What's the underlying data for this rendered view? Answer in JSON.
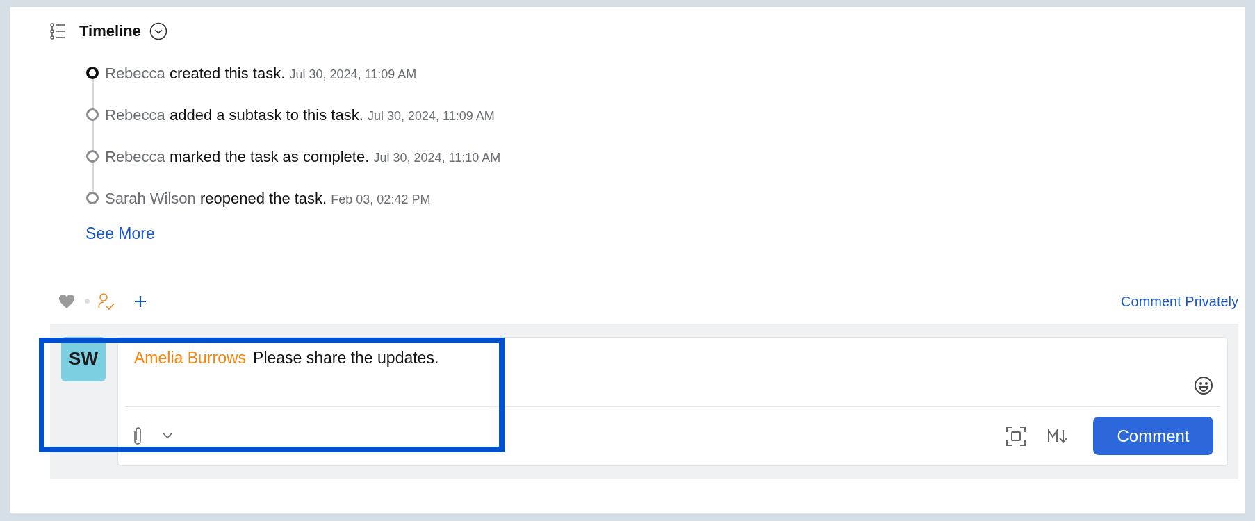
{
  "timeline": {
    "title": "Timeline",
    "entries": [
      {
        "actor": "Rebecca",
        "action": "created this task.",
        "time": "Jul 30, 2024, 11:09 AM",
        "active": true
      },
      {
        "actor": "Rebecca",
        "action": "added a subtask to this task.",
        "time": "Jul 30, 2024, 11:09 AM",
        "active": false
      },
      {
        "actor": "Rebecca",
        "action": "marked the task as complete.",
        "time": "Jul 30, 2024, 11:10 AM",
        "active": false
      },
      {
        "actor": "Sarah Wilson",
        "action": "reopened the task.",
        "time": "Feb 03, 02:42 PM",
        "active": false
      }
    ],
    "see_more": "See More"
  },
  "actions": {
    "comment_privately": "Comment Privately"
  },
  "composer": {
    "avatar": "SW",
    "mention": "Amelia Burrows",
    "text": "Please share the updates.",
    "submit": "Comment"
  }
}
